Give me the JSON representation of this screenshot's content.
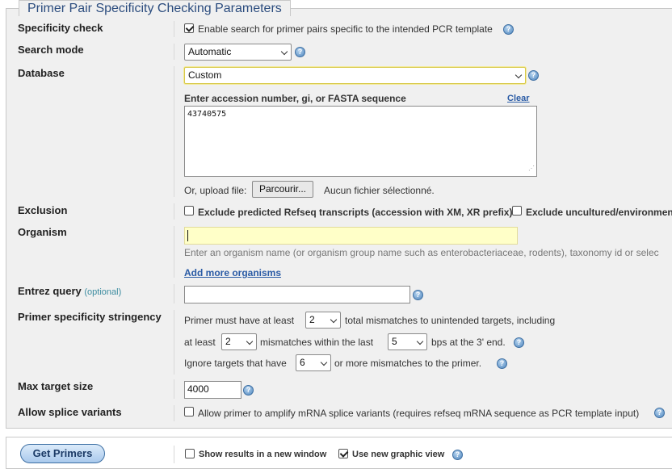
{
  "legend": "Primer Pair Specificity Checking Parameters",
  "labels": {
    "specificity_check": "Specificity check",
    "search_mode": "Search mode",
    "database": "Database",
    "exclusion": "Exclusion",
    "organism": "Organism",
    "entrez_query": "Entrez query",
    "entrez_optional": "(optional)",
    "stringency": "Primer specificity stringency",
    "max_target_size": "Max target size",
    "splice_variants": "Allow splice variants"
  },
  "specificity": {
    "text": "Enable search for primer pairs specific to the intended PCR template",
    "checked": true
  },
  "search_mode": {
    "value": "Automatic"
  },
  "database": {
    "value": "Custom"
  },
  "custom_seq": {
    "label": "Enter accession number, gi, or FASTA sequence",
    "clear": "Clear",
    "value": "43740575"
  },
  "upload": {
    "label": "Or, upload file:",
    "button": "Parcourir...",
    "status": "Aucun fichier sélectionné."
  },
  "exclusion": {
    "opt1": "Exclude predicted Refseq transcripts (accession with XM, XR prefix)",
    "opt2": "Exclude uncultured/environment"
  },
  "organism": {
    "value": "",
    "hint": "Enter an organism name (or organism group name such as enterobacteriaceae, rodents), taxonomy id or selec",
    "add_more": "Add more organisms"
  },
  "entrez": {
    "value": ""
  },
  "stringency": {
    "line1_prefix": "Primer must have at least",
    "total_mismatches": "2",
    "line1_suffix": "total mismatches to unintended targets, including",
    "line2_prefix": "at least",
    "mismatches_3prime": "2",
    "line2_mid": "mismatches within the last",
    "last_bps": "5",
    "line2_suffix": "bps at the 3' end.",
    "line3_prefix": "Ignore targets that have",
    "ignore_mismatches": "6",
    "line3_suffix": "or more mismatches to the primer."
  },
  "max_target": {
    "value": "4000"
  },
  "splice": {
    "text": "Allow primer to amplify mRNA splice variants (requires refseq mRNA sequence as PCR template input)",
    "checked": false
  },
  "bottom": {
    "get_primers": "Get Primers",
    "new_window": "Show results in a new window",
    "new_window_checked": false,
    "graphic_view": "Use new graphic view",
    "graphic_view_checked": true
  },
  "colors": {
    "highlight_input": "#ffffc8",
    "legend_text": "#2b4c7e",
    "link": "#2a5ba5"
  }
}
